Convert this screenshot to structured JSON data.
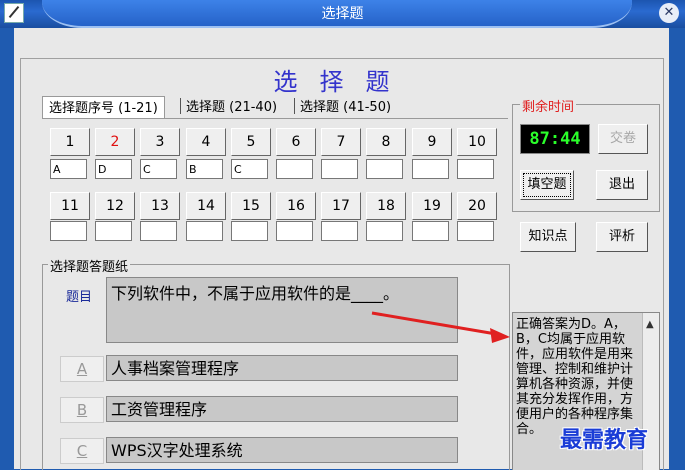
{
  "window": {
    "title": "选择题"
  },
  "heading": "选择题",
  "tabs": [
    {
      "label": "选择题序号 (1-21)"
    },
    {
      "label": "选择题 (21-40)"
    },
    {
      "label": "选择题 (41-50)"
    }
  ],
  "questions": {
    "row1": [
      "1",
      "2",
      "3",
      "4",
      "5",
      "6",
      "7",
      "8",
      "9",
      "10"
    ],
    "row1_answers": [
      "A",
      "D",
      "C",
      "B",
      "C",
      "",
      "",
      "",
      "",
      ""
    ],
    "row2": [
      "11",
      "12",
      "13",
      "14",
      "15",
      "16",
      "17",
      "18",
      "19",
      "20"
    ],
    "row2_answers": [
      "",
      "",
      "",
      "",
      "",
      "",
      "",
      "",
      "",
      ""
    ],
    "current": "2"
  },
  "timer": {
    "label": "剩余时间",
    "value": "87:44"
  },
  "buttons": {
    "submit": "交卷",
    "fill_empty": "填空题",
    "exit": "退出",
    "knowledge": "知识点",
    "analysis": "评析"
  },
  "answer_sheet": {
    "label": "选择题答题纸",
    "question_label": "题目",
    "question_text": "下列软件中，不属于应用软件的是____。",
    "options": [
      {
        "letter": "A",
        "text": "人事档案管理程序"
      },
      {
        "letter": "B",
        "text": "工资管理程序"
      },
      {
        "letter": "C",
        "text": "WPS汉字处理系统"
      }
    ]
  },
  "explanation": {
    "text": "正确答案为D。A，B，C均属于应用软件，应用软件是用来管理、控制和维护计算机各种资源，并使其充分发挥作用，方便用户的各种程序集合。"
  },
  "watermark": "最需教育",
  "colors": {
    "timer_fg": "#2aff2a",
    "heading": "#3333cc",
    "arrow": "#e02020"
  }
}
